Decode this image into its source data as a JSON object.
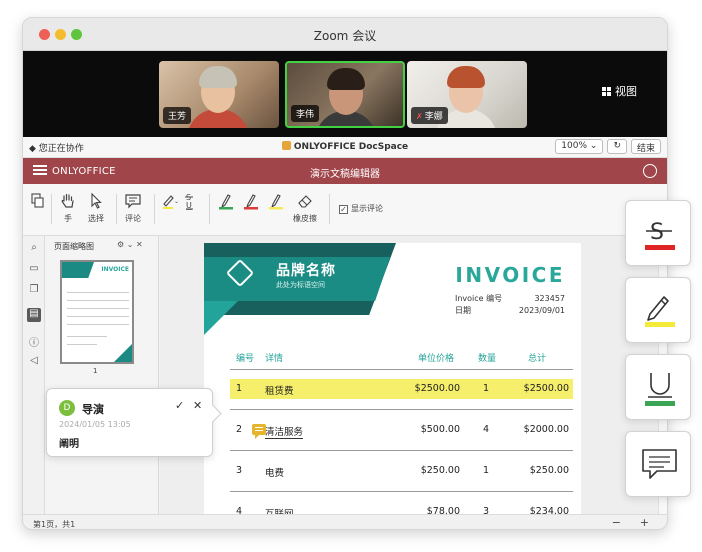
{
  "window": {
    "title": "Zoom 会议"
  },
  "zoom": {
    "participants": [
      {
        "name": "王芳",
        "muted": false
      },
      {
        "name": "李伟",
        "muted": false
      },
      {
        "name": "李娜",
        "muted": true
      }
    ],
    "view_label": "视图"
  },
  "collab": {
    "status": "您正在协作",
    "app_name": "ONLYOFFICE DocSpace",
    "zoom_value": "100%",
    "end_label": "结束"
  },
  "editor": {
    "brand": "ONLYOFFICE",
    "title": "演示文稿编辑器"
  },
  "toolbar": {
    "hand_label": "手",
    "select_label": "选择",
    "comment_label": "评论",
    "eraser_label": "橡皮擦",
    "show_comments_label": "显示评论",
    "show_comments_checked": true,
    "pen_colors": [
      "#3aa655",
      "#e03a3a",
      "#f4ea5a"
    ]
  },
  "thumbnails": {
    "header": "页面缩略图",
    "page_number": "1"
  },
  "invoice": {
    "brand_name": "品牌名称",
    "brand_subtitle": "此处为标语空间",
    "title": "INVOICE",
    "invoice_no_label": "Invoice 编号",
    "invoice_no": "323457",
    "date_label": "日期",
    "date": "2023/09/01",
    "columns": [
      "编号",
      "详情",
      "单位价格",
      "数量",
      "总计"
    ],
    "rows": [
      {
        "no": "1",
        "item": "租赁费",
        "price": "$2500.00",
        "qty": "1",
        "total": "$2500.00",
        "highlight": true
      },
      {
        "no": "2",
        "item": "清洁服务",
        "price": "$500.00",
        "qty": "4",
        "total": "$2000.00",
        "highlight": false
      },
      {
        "no": "3",
        "item": "电费",
        "price": "$250.00",
        "qty": "1",
        "total": "$250.00",
        "highlight": false
      },
      {
        "no": "4",
        "item": "互联网",
        "price": "$78.00",
        "qty": "3",
        "total": "$234.00",
        "highlight": false
      }
    ],
    "colors": {
      "teal": "#1b8c84",
      "dark_teal": "#17605d",
      "accent": "#2aa79b",
      "highlight": "#f5ef6c"
    }
  },
  "comment": {
    "avatar_initial": "D",
    "author": "导演",
    "date": "2024/01/05 13:05",
    "text": "阐明"
  },
  "statusbar": {
    "page_info": "第1页，共1",
    "zoom_out": "−",
    "zoom_in": "+"
  },
  "floating_tools": [
    {
      "icon": "strikethrough-icon",
      "color": "#e02424"
    },
    {
      "icon": "highlighter-icon",
      "color": "#f4ea3a"
    },
    {
      "icon": "underline-icon",
      "color": "#3aa655"
    },
    {
      "icon": "comment-icon",
      "color": ""
    }
  ]
}
